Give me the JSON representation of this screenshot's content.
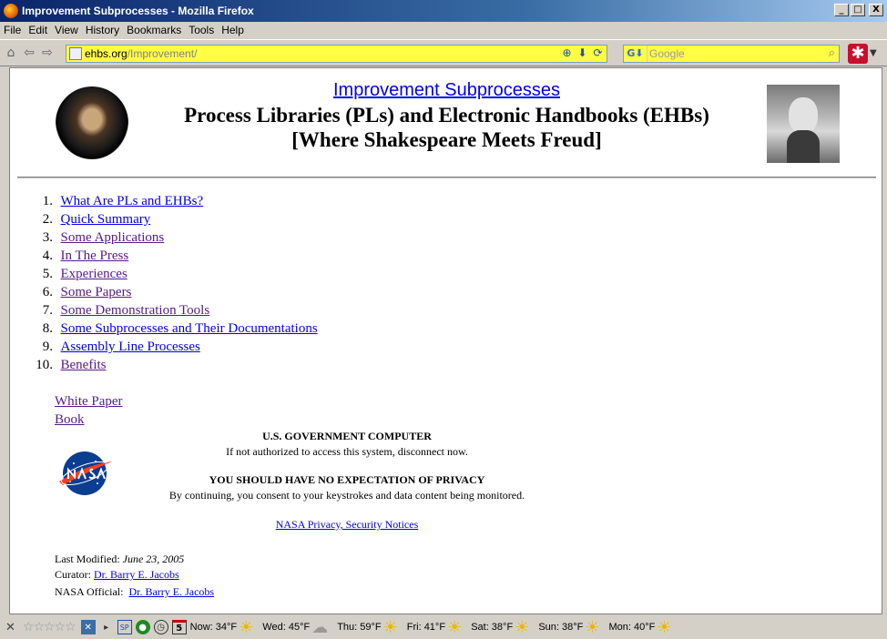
{
  "window": {
    "title": "Improvement Subprocesses - Mozilla Firefox",
    "buttons": {
      "minimize": "_",
      "maximize": "□",
      "close": "X"
    }
  },
  "menu": [
    "File",
    "Edit",
    "View",
    "History",
    "Bookmarks",
    "Tools",
    "Help"
  ],
  "urlbar": {
    "host": "ehbs.org",
    "path": "/Improvement/"
  },
  "search": {
    "placeholder": "Google"
  },
  "page": {
    "header_link": "Improvement Subprocesses",
    "title": "Process Libraries (PLs) and Electronic Handbooks (EHBs)",
    "subtitle": "[Where Shakespeare Meets Freud]",
    "toc": [
      {
        "num": "1.",
        "label": "What Are PLs and EHBs?",
        "visited": false
      },
      {
        "num": "2.",
        "label": "Quick Summary",
        "visited": false
      },
      {
        "num": "3.",
        "label": "Some Applications",
        "visited": true
      },
      {
        "num": "4.",
        "label": "In The Press",
        "visited": true
      },
      {
        "num": "5.",
        "label": "Experiences",
        "visited": true
      },
      {
        "num": "6.",
        "label": "Some Papers",
        "visited": true
      },
      {
        "num": "7.",
        "label": "Some Demonstration Tools",
        "visited": true
      },
      {
        "num": "8.",
        "label": "Some Subprocesses and Their Documentations",
        "visited": false
      },
      {
        "num": "9.",
        "label": "Assembly Line Processes",
        "visited": false
      },
      {
        "num": "10.",
        "label": "Benefits",
        "visited": true
      }
    ],
    "extra_links": [
      "White Paper",
      "Book"
    ],
    "notice": {
      "heading1": "U.S. GOVERNMENT COMPUTER",
      "line1": "If not authorized to access this system, disconnect now.",
      "heading2": "YOU SHOULD HAVE NO EXPECTATION OF PRIVACY",
      "line2": "By continuing, you consent to your keystrokes and data content being monitored.",
      "privacy_link": "NASA Privacy, Security Notices"
    },
    "footer": {
      "modified_label": "Last Modified:",
      "modified_date": "June 23, 2005",
      "curator_label": "Curator:",
      "curator_name": "Dr. Barry E. Jacobs",
      "official_label": "NASA Official:",
      "official_name": "Dr. Barry E. Jacobs"
    }
  },
  "statusbar": {
    "weather": [
      {
        "label": "Now: 34°F",
        "icon": "sun-cloud-icon"
      },
      {
        "label": "Wed: 45°F",
        "icon": "cloud-icon"
      },
      {
        "label": "Thu: 59°F",
        "icon": "sun-cloud-icon"
      },
      {
        "label": "Fri: 41°F",
        "icon": "sun-cloud-icon"
      },
      {
        "label": "Sat: 38°F",
        "icon": "sun-cloud-icon"
      },
      {
        "label": "Sun: 38°F",
        "icon": "sun-cloud-icon"
      },
      {
        "label": "Mon: 40°F",
        "icon": "sun-cloud-icon"
      }
    ],
    "sp": "SP",
    "calendar_day": "5"
  },
  "colors": {
    "link": "#0000ee",
    "visited": "#551a8b",
    "urlbar_bg": "#ffff44"
  }
}
